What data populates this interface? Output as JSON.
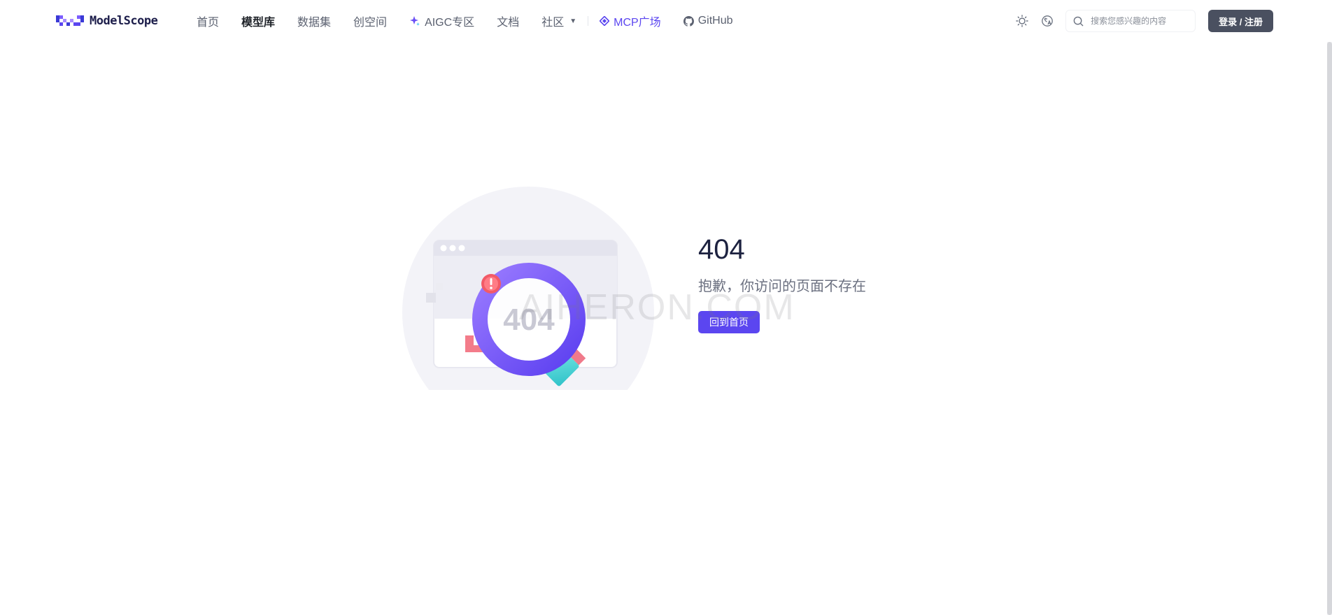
{
  "header": {
    "logo_text": "ModelScope",
    "nav": [
      {
        "label": "首页",
        "name": "nav-home"
      },
      {
        "label": "模型库",
        "name": "nav-models",
        "active": true
      },
      {
        "label": "数据集",
        "name": "nav-datasets"
      },
      {
        "label": "创空间",
        "name": "nav-studios"
      },
      {
        "label": "AIGC专区",
        "name": "nav-aigc",
        "icon": "sparkle-icon"
      },
      {
        "label": "文档",
        "name": "nav-docs"
      },
      {
        "label": "社区",
        "name": "nav-community",
        "icon": "caret-down-icon"
      },
      {
        "label": "MCP广场",
        "name": "nav-mcp",
        "icon": "mcp-diamond-icon"
      },
      {
        "label": "GitHub",
        "name": "nav-github",
        "icon": "github-icon"
      }
    ],
    "search_placeholder": "搜索您感兴趣的内容",
    "login_label": "登录 / 注册",
    "accent_color": "#5b46f0"
  },
  "error": {
    "code": "404",
    "message": "抱歉，你访问的页面不存在",
    "illustration_code": "404",
    "back_button": "回到首页"
  },
  "watermark": "AIHERON.COM"
}
